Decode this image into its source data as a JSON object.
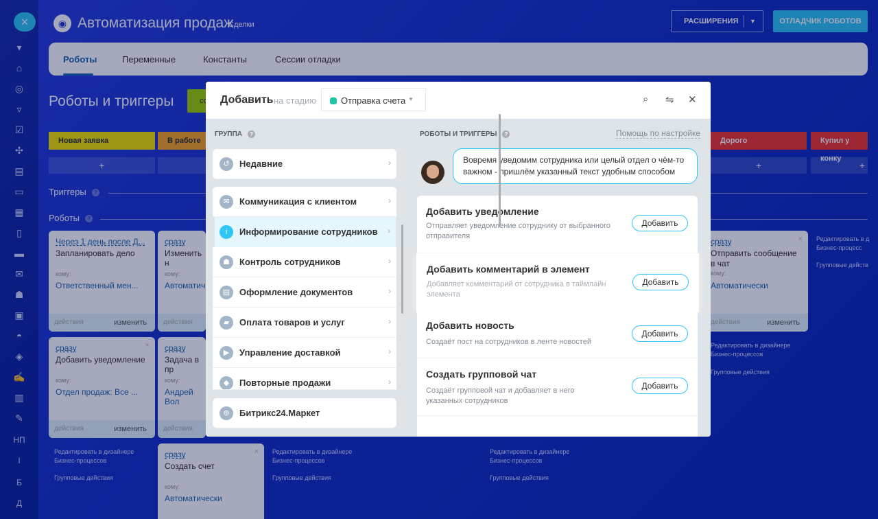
{
  "header": {
    "title": "Автоматизация продаж",
    "subtitle": "Сделки",
    "extensions_btn": "РАСШИРЕНИЯ",
    "debug_btn": "ОТЛАДЧИК РОБОТОВ"
  },
  "tabs": [
    "Роботы",
    "Переменные",
    "Константы",
    "Сессии отладки"
  ],
  "sidebar": {
    "letters": [
      "НП",
      "I",
      "Б",
      "Д"
    ]
  },
  "page": {
    "section_title": "Роботы и триггеры",
    "green_btn_partial": "со",
    "stages": [
      "Новая заявка",
      "В работе",
      "Дорого",
      "Купил у конку"
    ],
    "plus": "+",
    "triggers_label": "Триггеры",
    "robots_label": "Роботы",
    "cards": [
      {
        "delay": "Через 1 день после Д...",
        "title": "Запланировать дело",
        "to_label": "кому:",
        "to": "Ответственный мен...",
        "actions": "действия",
        "change": "изменить"
      },
      {
        "delay": "сразу",
        "title": "Изменить н",
        "to_label": "кому:",
        "to": "Автоматич",
        "actions": "действия"
      },
      {
        "delay": "сразу",
        "title": "Добавить уведомление",
        "to_label": "кому:",
        "to": "Отдел продаж: Все ...",
        "actions": "действия",
        "change": "изменить"
      },
      {
        "delay": "сразу",
        "title": "Задача в пр",
        "to_label": "кому:",
        "to": "Андрей Вол",
        "actions": "действия"
      },
      {
        "delay": "сразу",
        "title": "Создать счет",
        "to_label": "кому:",
        "to": "Автоматически"
      },
      {
        "delay": "сразу",
        "title": "Отправить сообщение в чат",
        "to_label": "кому:",
        "to": "Автоматически",
        "actions": "действия",
        "change": "изменить"
      }
    ],
    "edit_designer_1": "Редактировать в дизайнере",
    "edit_designer_2": "Бизнес-процессов",
    "group_actions": "Групповые действия",
    "edit_designer_short": "Редактировать в д",
    "bp_short": "Бизнес-процесс",
    "group_short": "Групповые действ"
  },
  "modal": {
    "title": "Добавить",
    "stage_label": "на стадию",
    "stage_value": "Отправка счета",
    "group_header": "ГРУППА",
    "groups": [
      {
        "label": "Недавние",
        "icon": "history-icon"
      },
      {
        "label": "Коммуникация с клиентом",
        "icon": "chat-icon"
      },
      {
        "label": "Информирование сотрудников",
        "icon": "info-icon"
      },
      {
        "label": "Контроль сотрудников",
        "icon": "people-icon"
      },
      {
        "label": "Оформление документов",
        "icon": "document-icon"
      },
      {
        "label": "Оплата товаров и услуг",
        "icon": "wallet-icon"
      },
      {
        "label": "Управление доставкой",
        "icon": "truck-icon"
      },
      {
        "label": "Повторные продажи",
        "icon": "sales-icon"
      },
      {
        "label": "Битрикс24.Маркет",
        "icon": "market-icon"
      }
    ],
    "robots_header": "РОБОТЫ И ТРИГГЕРЫ",
    "help_link": "Помощь по настройке",
    "hint": "Вовремя уведомим сотрудника или целый отдел о чём-то важном - пришлём указанный текст удобным способом",
    "add_label": "Добавить",
    "robots": [
      {
        "title": "Добавить уведомление",
        "desc": "Отправляет уведомление сотруднику от выбранного отправителя"
      },
      {
        "title": "Добавить комментарий в элемент",
        "desc": "Добавляет комментарий от сотрудника в таймлайн элемента"
      },
      {
        "title": "Добавить новость",
        "desc": "Создаёт пост на сотрудников в ленте новостей"
      },
      {
        "title": "Создать групповой чат",
        "desc": "Создаёт групповой чат и добавляет в него указанных сотрудников"
      }
    ]
  }
}
